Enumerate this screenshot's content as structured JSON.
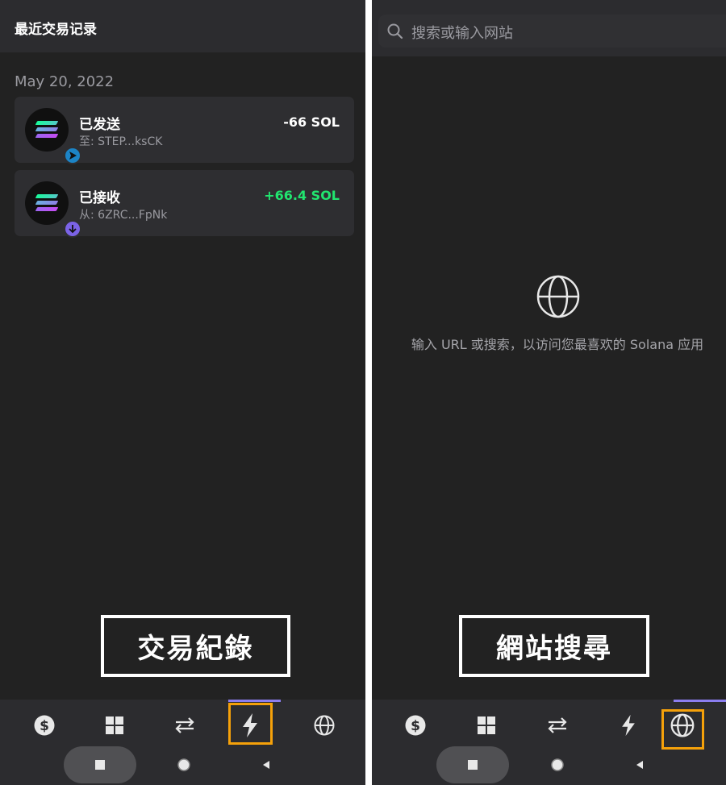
{
  "left": {
    "header_title": "最近交易记录",
    "date": "May 20, 2022",
    "transactions": [
      {
        "title": "已发送",
        "subtitle": "至: STEP...ksCK",
        "amount": "-66 SOL",
        "type": "send"
      },
      {
        "title": "已接收",
        "subtitle": "从: 6ZRC...FpNk",
        "amount": "+66.4 SOL",
        "type": "receive"
      }
    ],
    "caption": "交易紀錄",
    "active_tab": "activity"
  },
  "right": {
    "search_placeholder": "搜索或输入网站",
    "empty_message": "输入 URL 或搜索，以访问您最喜欢的 Solana 应用",
    "caption": "網站搜尋",
    "active_tab": "browser"
  },
  "tabs": [
    {
      "id": "wallet",
      "icon": "dollar-circle-icon"
    },
    {
      "id": "collectibles",
      "icon": "grid-icon"
    },
    {
      "id": "swap",
      "icon": "swap-arrows-icon"
    },
    {
      "id": "activity",
      "icon": "lightning-icon"
    },
    {
      "id": "browser",
      "icon": "globe-icon"
    }
  ],
  "colors": {
    "background": "#222222",
    "card": "#2e2e31",
    "positive_amount": "#21e56f",
    "tab_indicator": "#8b7ef0",
    "highlight": "#f5a10a",
    "send_badge": "#1c84c6",
    "receive_badge": "#7b63e6"
  }
}
